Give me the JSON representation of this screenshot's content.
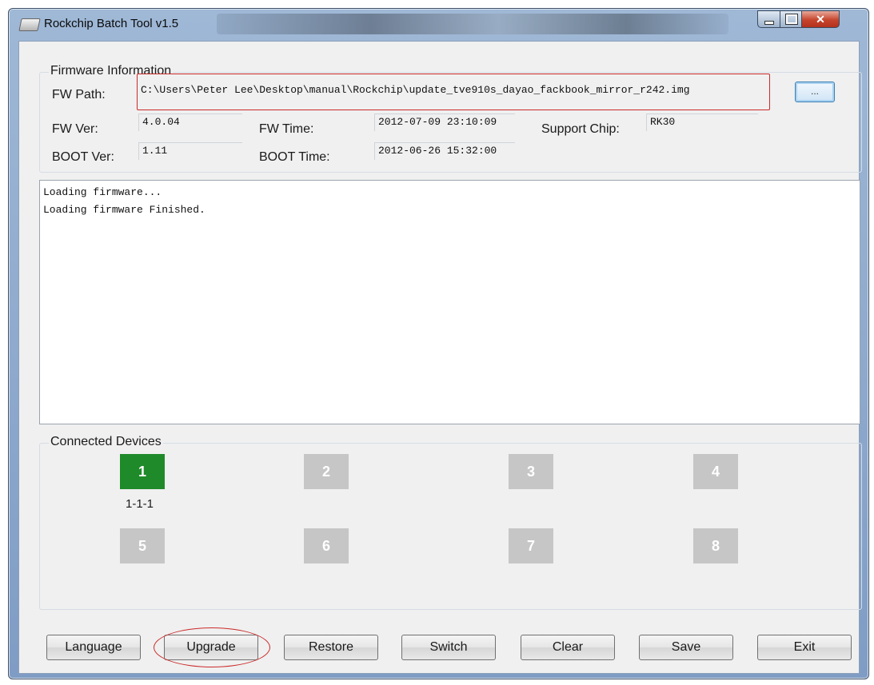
{
  "window": {
    "title": "Rockchip Batch Tool v1.5"
  },
  "firmware": {
    "group_label": "Firmware Information",
    "fw_path_label": "FW Path:",
    "fw_path_value": "C:\\Users\\Peter Lee\\Desktop\\manual\\Rockchip\\update_tve910s_dayao_fackbook_mirror_r242.img",
    "browse_label": "...",
    "fw_ver_label": "FW Ver:",
    "fw_ver_value": "4.0.04",
    "fw_time_label": "FW Time:",
    "fw_time_value": "2012-07-09 23:10:09",
    "support_chip_label": "Support Chip:",
    "support_chip_value": "RK30",
    "boot_ver_label": "BOOT Ver:",
    "boot_ver_value": "1.11",
    "boot_time_label": "BOOT Time:",
    "boot_time_value": "2012-06-26 15:32:00"
  },
  "log": {
    "lines": [
      "Loading firmware...",
      "Loading firmware Finished."
    ]
  },
  "devices": {
    "group_label": "Connected Devices",
    "slots": [
      {
        "label": "1",
        "active": true,
        "sub": "1-1-1"
      },
      {
        "label": "2",
        "active": false
      },
      {
        "label": "3",
        "active": false
      },
      {
        "label": "4",
        "active": false
      },
      {
        "label": "5",
        "active": false
      },
      {
        "label": "6",
        "active": false
      },
      {
        "label": "7",
        "active": false
      },
      {
        "label": "8",
        "active": false
      }
    ]
  },
  "buttons": {
    "language": "Language",
    "upgrade": "Upgrade",
    "restore": "Restore",
    "switch": "Switch",
    "clear": "Clear",
    "save": "Save",
    "exit": "Exit"
  },
  "colors": {
    "active_device": "#1f8a2a",
    "inactive_device": "#c6c6c6",
    "highlight": "#cc2a2a"
  },
  "icons": [
    "app-icon",
    "minimize-icon",
    "maximize-icon",
    "close-icon"
  ]
}
